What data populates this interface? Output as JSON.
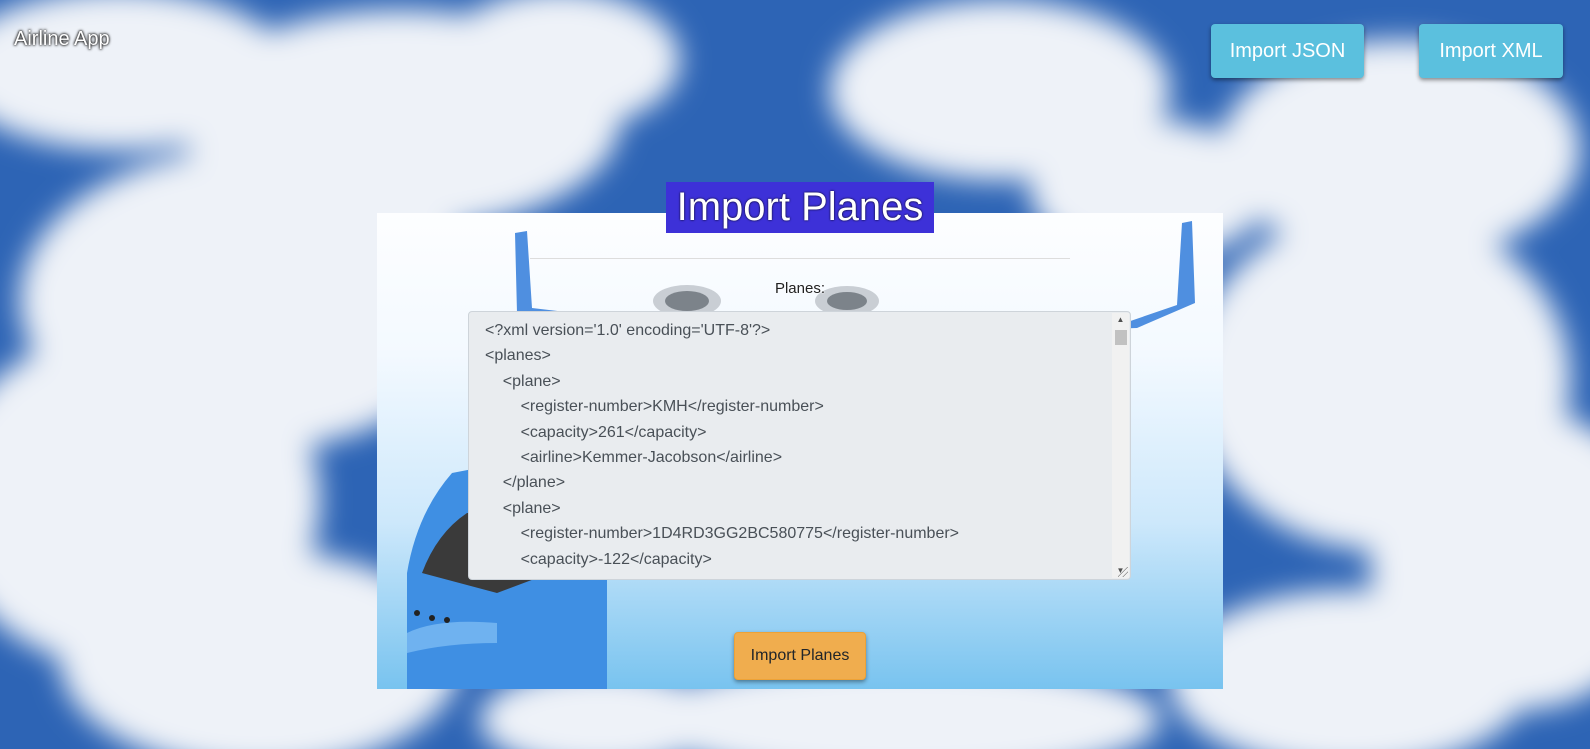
{
  "header": {
    "brand": "Airline App",
    "import_json_label": "Import JSON",
    "import_xml_label": "Import XML"
  },
  "main": {
    "title": "Import Planes",
    "planes_label": "Planes:",
    "xml_content": "<?xml version='1.0' encoding='UTF-8'?>\n<planes>\n    <plane>\n        <register-number>KMH</register-number>\n        <capacity>261</capacity>\n        <airline>Kemmer-Jacobson</airline>\n    </plane>\n    <plane>\n        <register-number>1D4RD3GG2BC580775</register-number>\n        <capacity>-122</capacity>",
    "submit_label": "Import Planes"
  },
  "colors": {
    "nav_button": "#5bc0de",
    "title_highlight": "#3d31d8",
    "submit_button": "#f0ad4e"
  },
  "icons": [
    "scroll-up-arrow-icon",
    "scroll-down-arrow-icon",
    "resize-grip-icon"
  ]
}
